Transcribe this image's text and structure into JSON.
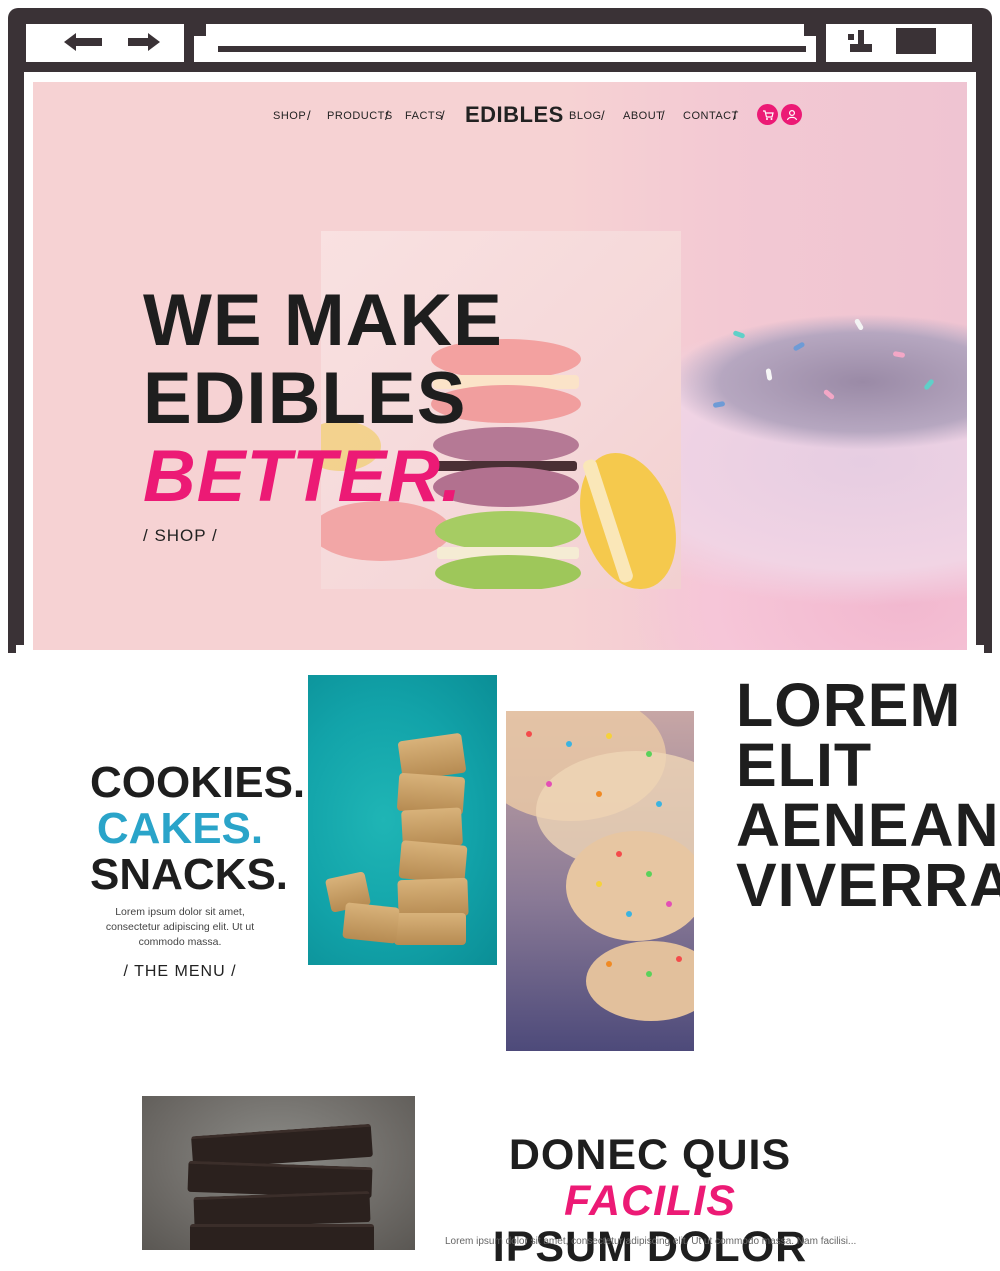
{
  "nav": {
    "items_left": [
      "SHOP",
      "PRODUCTS",
      "FACTS"
    ],
    "brand": "EDIBLES",
    "items_right": [
      "BLOG",
      "ABOUT",
      "CONTACT"
    ],
    "separator": "/"
  },
  "hero": {
    "line1": "WE MAKE",
    "line2": "EDIBLES",
    "line3": "BETTER.",
    "cta": "/ SHOP /"
  },
  "section2": {
    "line1": "COOKIES.",
    "line2": "CAKES.",
    "line3": "SNACKS.",
    "copy": "Lorem ipsum dolor sit amet, consectetur adipiscing elit. Ut ut commodo massa.",
    "cta": "/ THE MENU /",
    "right_lines": [
      "LOREM",
      "ELIT",
      "AENEAN",
      "VIVERRA"
    ]
  },
  "section3": {
    "title_part1": "DONEC QUIS",
    "title_pink": "FACILIS",
    "title_line2": "IPSUM DOLOR",
    "copy": "Lorem ipsum dolor sit amet, consectetur adipiscing elit. Ut ut commodo massa. Nam facilisi..."
  },
  "colors": {
    "accent_pink": "#ec1a75",
    "accent_teal": "#2aa4c9",
    "hero_bg": "#f6d2d3",
    "frame": "#3a3236"
  },
  "icons": [
    "back-arrow-icon",
    "forward-arrow-icon",
    "minimize-icon",
    "maximize-icon",
    "cart-icon",
    "user-icon"
  ]
}
